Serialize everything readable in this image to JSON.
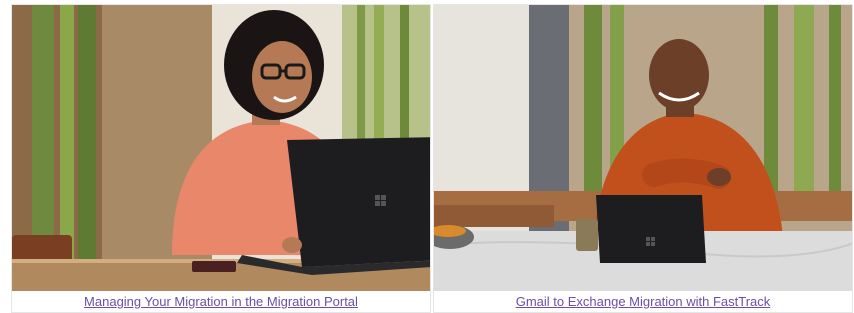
{
  "cards": [
    {
      "image": "woman-with-laptop-photo",
      "link_text": "Managing Your Migration in the Migration Portal"
    },
    {
      "image": "man-with-tablet-photo",
      "link_text": "Gmail to Exchange Migration with FastTrack"
    }
  ],
  "colors": {
    "link": "#6b4fa8",
    "card_border": "#e6e6e6"
  }
}
